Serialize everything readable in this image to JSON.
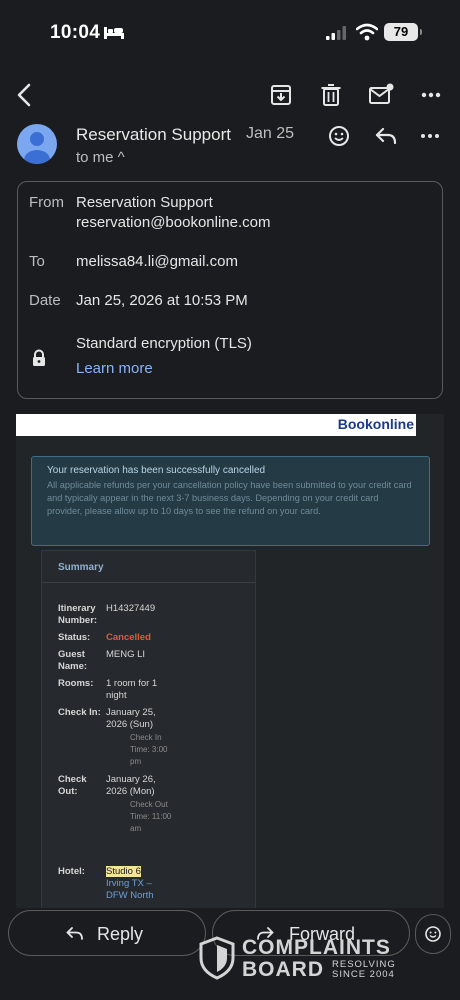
{
  "status_bar": {
    "time": "10:04",
    "battery": "79"
  },
  "header": {
    "sender": "Reservation Support",
    "date": "Jan 25",
    "recipient_summary": "to me ^"
  },
  "details": {
    "from_label": "From",
    "from_name": "Reservation Support",
    "from_email": "reservation@bookonline.com",
    "to_label": "To",
    "to_value": "melissa84.li@gmail.com",
    "date_label": "Date",
    "date_value": "Jan 25, 2026 at 10:53 PM",
    "encryption": "Standard encryption (TLS)",
    "learn_more": "Learn more"
  },
  "email": {
    "brand": "Bookonline",
    "notice_title": "Your reservation has been successfully cancelled",
    "notice_text": "All applicable refunds per your cancellation policy have been submitted to your credit card and typically appear in the next 3-7 business days. Depending on your credit card provider, please allow up to 10 days to see the refund on your card.",
    "summary_title": "Summary",
    "summary": {
      "itinerary_label": "Itinerary Number:",
      "itinerary_value": "H14327449",
      "status_label": "Status:",
      "status_value": "Cancelled",
      "guest_label": "Guest Name:",
      "guest_value": "MENG LI",
      "rooms_label": "Rooms:",
      "rooms_value": "1 room for 1 night",
      "checkin_label": "Check In:",
      "checkin_value": "January 25, 2026 (Sun)",
      "checkin_time": "Check In Time: 3:00 pm",
      "checkout_label": "Check Out:",
      "checkout_value": "January 26, 2026 (Mon)",
      "checkout_time": "Check Out Time: 11:00 am",
      "hotel_label": "Hotel:",
      "hotel_name": "Studio 6",
      "hotel_location": "Irving TX – DFW North"
    }
  },
  "bottom": {
    "reply": "Reply",
    "forward": "Forward"
  },
  "watermark": {
    "line1": "COMPLAINTS",
    "line2": "BOARD",
    "line3": "RESOLVING SINCE 2004"
  },
  "colors": {
    "background": "#1b1c1f",
    "link": "#8ab4f8",
    "cancelled": "#e05a3c",
    "highlight": "#f3e49a"
  },
  "icons": [
    "bed-icon",
    "signal-icon",
    "wifi-icon",
    "battery-icon",
    "back-arrow-icon",
    "archive-icon",
    "trash-icon",
    "mark-unread-icon",
    "more-vert-icon",
    "avatar-icon",
    "emoji-icon",
    "reply-icon",
    "lock-icon",
    "forward-icon",
    "shield-logo-icon"
  ]
}
